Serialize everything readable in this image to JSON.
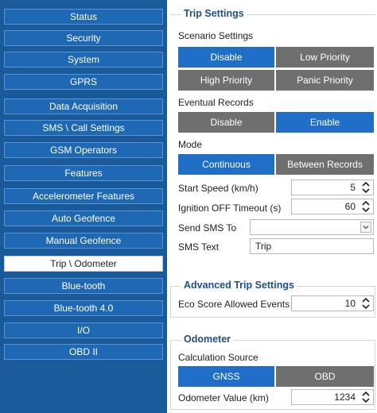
{
  "sidebar": {
    "items": [
      {
        "label": "Status"
      },
      {
        "label": "Security"
      },
      {
        "label": "System"
      },
      {
        "label": "GPRS"
      },
      {
        "label": "Data Acquisition"
      },
      {
        "label": "SMS \\ Call Settings"
      },
      {
        "label": "GSM Operators"
      },
      {
        "label": "Features"
      },
      {
        "label": "Accelerometer Features"
      },
      {
        "label": "Auto Geofence"
      },
      {
        "label": "Manual Geofence"
      },
      {
        "label": "Trip \\ Odometer",
        "active": true
      },
      {
        "label": "Blue-tooth"
      },
      {
        "label": "Blue-tooth 4.0"
      },
      {
        "label": "I/O"
      },
      {
        "label": "OBD II"
      }
    ]
  },
  "trip": {
    "title": "Trip Settings",
    "scenario_label": "Scenario Settings",
    "scenario_options": [
      "Disable",
      "Low Priority",
      "High Priority",
      "Panic Priority"
    ],
    "scenario_selected": "Disable",
    "eventual_label": "Eventual Records",
    "eventual_options": [
      "Disable",
      "Enable"
    ],
    "eventual_selected": "Enable",
    "mode_label": "Mode",
    "mode_options": [
      "Continuous",
      "Between Records"
    ],
    "mode_selected": "Continuous",
    "start_speed_label": "Start Speed (km/h)",
    "start_speed_value": "5",
    "ignition_label": "Ignition OFF Timeout (s)",
    "ignition_value": "60",
    "send_sms_label": "Send SMS To",
    "send_sms_value": "",
    "sms_text_label": "SMS Text",
    "sms_text_value": "Trip"
  },
  "advanced": {
    "title": "Advanced Trip Settings",
    "eco_label": "Eco Score Allowed Events",
    "eco_value": "10"
  },
  "odometer": {
    "title": "Odometer",
    "calc_label": "Calculation Source",
    "calc_options": [
      "GNSS",
      "OBD"
    ],
    "calc_selected": "GNSS",
    "value_label": "Odometer Value (km)",
    "value": "1234"
  },
  "colors": {
    "sidebar_bg": "#1b5a9a",
    "nav_btn": "#1f68b4",
    "selected": "#1f6fc6",
    "unselected": "#6f6f6f",
    "group_title": "#1f4e8c"
  },
  "icons": {
    "spin": "up-down-arrows-icon",
    "dropdown": "chevron-down-icon"
  }
}
